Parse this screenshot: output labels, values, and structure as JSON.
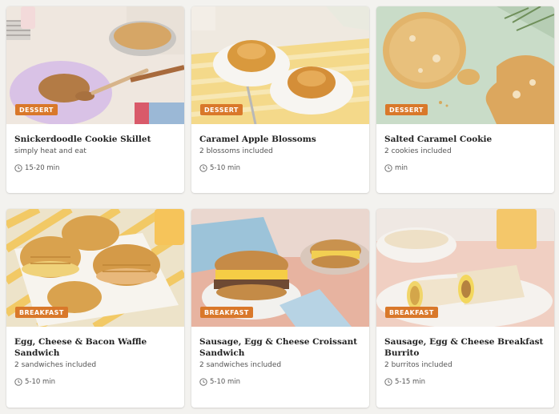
{
  "cards": [
    {
      "badge": "DESSERT",
      "title": "Snickerdoodle Cookie Skillet",
      "subtitle": "simply heat and eat",
      "time": "15-20 min",
      "time_icon": "clock-icon"
    },
    {
      "badge": "DESSERT",
      "title": "Caramel Apple Blossoms",
      "subtitle": "2 blossoms included",
      "time": "5-10 min",
      "time_icon": "clock-icon"
    },
    {
      "badge": "DESSERT",
      "title": "Salted Caramel Cookie",
      "subtitle": "2 cookies included",
      "time": "min",
      "time_icon": "clock-icon"
    },
    {
      "badge": "BREAKFAST",
      "title": "Egg, Cheese & Bacon Waffle Sandwich",
      "subtitle": "2 sandwiches included",
      "time": "5-10 min",
      "time_icon": "clock-icon"
    },
    {
      "badge": "BREAKFAST",
      "title": "Sausage, Egg & Cheese Croissant Sandwich",
      "subtitle": "2 sandwiches included",
      "time": "5-10 min",
      "time_icon": "clock-icon"
    },
    {
      "badge": "BREAKFAST",
      "title": "Sausage, Egg & Cheese Breakfast Burrito",
      "subtitle": "2 burritos included",
      "time": "5-15 min",
      "time_icon": "clock-icon"
    }
  ],
  "colors": {
    "badge": "#d9782a",
    "background": "#f3f2ef",
    "card": "#ffffff"
  }
}
